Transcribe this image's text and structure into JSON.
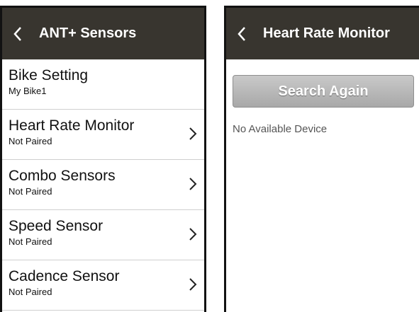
{
  "left": {
    "title": "ANT+ Sensors",
    "items": [
      {
        "label": "Bike Setting",
        "sub": "My Bike1",
        "chevron": false
      },
      {
        "label": "Heart Rate Monitor",
        "sub": "Not Paired",
        "chevron": true
      },
      {
        "label": "Combo Sensors",
        "sub": "Not Paired",
        "chevron": true
      },
      {
        "label": "Speed Sensor",
        "sub": "Not Paired",
        "chevron": true
      },
      {
        "label": "Cadence Sensor",
        "sub": "Not Paired",
        "chevron": true
      }
    ]
  },
  "right": {
    "title": "Heart Rate Monitor",
    "search_label": "Search Again",
    "empty_text": "No Available Device"
  },
  "colors": {
    "titlebar": "#38352f",
    "frame": "#121212",
    "divider": "#cfcfcf",
    "button": "#b5b5b5"
  },
  "icons": {
    "back": "chevron-left-icon",
    "row": "chevron-right-icon"
  }
}
